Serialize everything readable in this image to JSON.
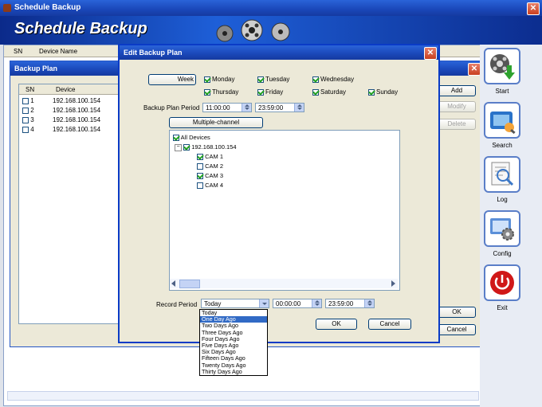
{
  "main_window": {
    "title": "Schedule Backup",
    "banner": "Schedule Backup"
  },
  "main_table": {
    "columns": [
      "SN",
      "Device Name"
    ]
  },
  "backup_plan": {
    "title": "Backup Plan",
    "columns": [
      "SN",
      "Device"
    ],
    "rows": [
      {
        "sn": "1",
        "device": "192.168.100.154"
      },
      {
        "sn": "2",
        "device": "192.168.100.154"
      },
      {
        "sn": "3",
        "device": "192.168.100.154"
      },
      {
        "sn": "4",
        "device": "192.168.100.154"
      }
    ],
    "add_label": "Add",
    "modify_label": "Modify",
    "delete_label": "Delete",
    "ok_label": "OK",
    "cancel_label": "Cancel"
  },
  "dialog": {
    "title": "Edit Backup Plan",
    "week_label": "Week",
    "days": {
      "monday": "Monday",
      "tuesday": "Tuesday",
      "wednesday": "Wednesday",
      "thursday": "Thursday",
      "friday": "Friday",
      "saturday": "Saturday",
      "sunday": "Sunday"
    },
    "period_label": "Backup Plan Period",
    "period_start": "11:00:00",
    "period_end": "23:59:00",
    "multichannel_label": "Multiple-channel",
    "tree": {
      "root": "All Devices",
      "device": "192.168.100.154",
      "cameras": [
        {
          "label": "CAM 1",
          "checked": true
        },
        {
          "label": "CAM 2",
          "checked": false
        },
        {
          "label": "CAM 3",
          "checked": true
        },
        {
          "label": "CAM 4",
          "checked": false
        }
      ]
    },
    "record_period_label": "Record Period",
    "record_selected": "Today",
    "record_start": "00:00:00",
    "record_end": "23:59:00",
    "ok_label": "OK",
    "cancel_label": "Cancel",
    "dropdown_options": [
      "Today",
      "One Day Ago",
      "Two Days Ago",
      "Three Days Ago",
      "Four Days Ago",
      "Five Days Ago",
      "Six Days Ago",
      "Fifteen Days Ago",
      "Twenty Days Ago",
      "Thirty Days Ago"
    ],
    "dropdown_highlighted": "One Day Ago"
  },
  "sidebar": {
    "items": [
      {
        "label": "Start",
        "icon": "film-reel-download-icon"
      },
      {
        "label": "Search",
        "icon": "search-film-icon"
      },
      {
        "label": "Log",
        "icon": "log-magnifier-icon"
      },
      {
        "label": "Config",
        "icon": "config-gears-icon"
      },
      {
        "label": "Exit",
        "icon": "power-icon"
      }
    ]
  },
  "colors": {
    "xp_blue": "#1a47b8",
    "highlight": "#316ac5",
    "check_green": "#21a121",
    "exit_red": "#d01818"
  }
}
